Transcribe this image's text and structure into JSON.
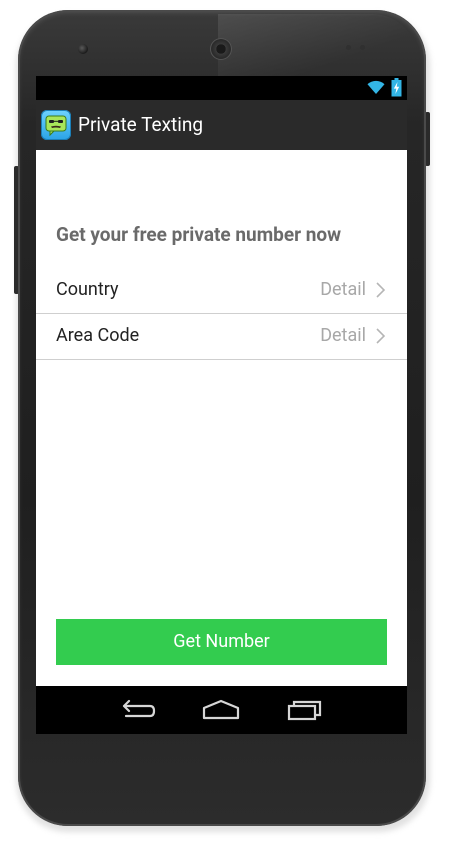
{
  "app": {
    "title": "Private Texting",
    "icon": "masked-face-chat-icon"
  },
  "status_bar": {
    "icons": [
      "wifi-icon",
      "battery-charging-icon"
    ],
    "accent_color": "#33b5e5"
  },
  "main": {
    "headline": "Get your free private number now",
    "rows": [
      {
        "label": "Country",
        "detail": "Detail"
      },
      {
        "label": "Area Code",
        "detail": "Detail"
      }
    ],
    "primary_button": {
      "label": "Get Number",
      "color": "#33cc4f"
    }
  },
  "nav_bar": {
    "buttons": [
      "back-icon",
      "home-icon",
      "recent-apps-icon"
    ]
  }
}
